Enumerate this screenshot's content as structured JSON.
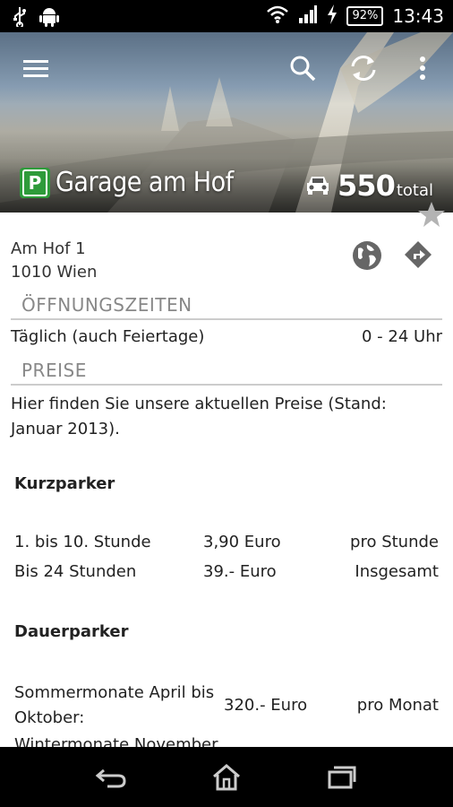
{
  "status_bar": {
    "battery": "92%",
    "time": "13:43",
    "icons": [
      "usb-icon",
      "android-icon",
      "wifi-icon",
      "signal-icon",
      "charging-icon",
      "battery-icon"
    ]
  },
  "toolbar": {
    "icons": [
      "menu-icon",
      "search-icon",
      "refresh-icon",
      "overflow-icon"
    ]
  },
  "garage": {
    "badge": "P",
    "name": "Garage am Hof",
    "capacity": "550",
    "capacity_unit": "total",
    "address_line1": "Am Hof 1",
    "address_line2": "1010 Wien"
  },
  "sections": {
    "hours_title": "ÖFFNUNGSZEITEN",
    "hours_label": "Täglich (auch Feiertage)",
    "hours_value": "0 - 24 Uhr",
    "prices_title": "PREISE",
    "prices_intro": "Hier finden Sie unsere aktuellen Preise (Stand: Januar 2013)."
  },
  "kurzparker": {
    "title": "Kurzparker",
    "rows": [
      {
        "label": "1. bis 10. Stunde",
        "price": "3,90 Euro",
        "unit": "pro Stunde"
      },
      {
        "label": "Bis 24 Stunden",
        "price": "39.- Euro",
        "unit": "Insgesamt"
      }
    ]
  },
  "dauerparker": {
    "title": "Dauerparker",
    "rows": [
      {
        "label_line1": "Sommermonate April bis",
        "label_line2": "Oktober:",
        "price": "320.- Euro",
        "unit": "pro Monat"
      },
      {
        "label_line1": "Wintermonate November",
        "label_line2": "",
        "price": "",
        "unit": ""
      }
    ]
  },
  "colors": {
    "accent_green": "#2e9b3a",
    "divider": "#cccccc",
    "section_text": "#888888"
  }
}
